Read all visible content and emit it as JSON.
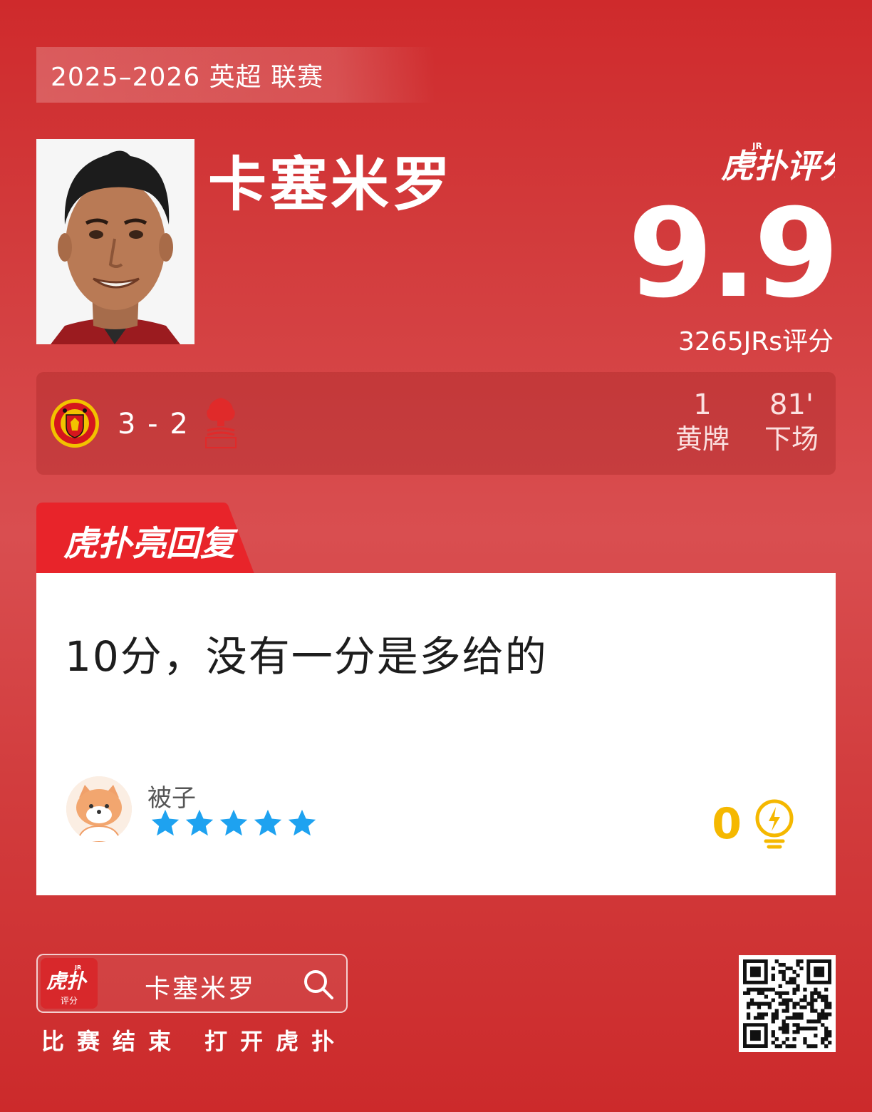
{
  "header": {
    "season_label": "2025–2026 英超 联赛",
    "player_name": "卡塞米罗",
    "brand": "虎扑评分",
    "rating": "9.9",
    "rating_count": "3265JRs评分"
  },
  "match": {
    "home_team": "Manchester United",
    "away_team": "Nottingham Forest",
    "score": "3 - 2",
    "stats": [
      {
        "value": "1",
        "label": "黄牌"
      },
      {
        "value": "81'",
        "label": "下场"
      }
    ]
  },
  "comment_section": {
    "tab_label": "虎扑亮回复",
    "comment_text": "10分，没有一分是多给的",
    "username": "被子",
    "stars": 5,
    "likes": "0"
  },
  "footer": {
    "app_icon_label": "虎扑",
    "app_icon_sub": "评分",
    "search_text": "卡塞米罗",
    "cta": "比赛结束 打开虎扑"
  },
  "colors": {
    "primary_red": "#d23a3b",
    "accent_red": "#e8242a",
    "star_blue": "#1ea2f0",
    "like_yellow": "#f5b800"
  }
}
